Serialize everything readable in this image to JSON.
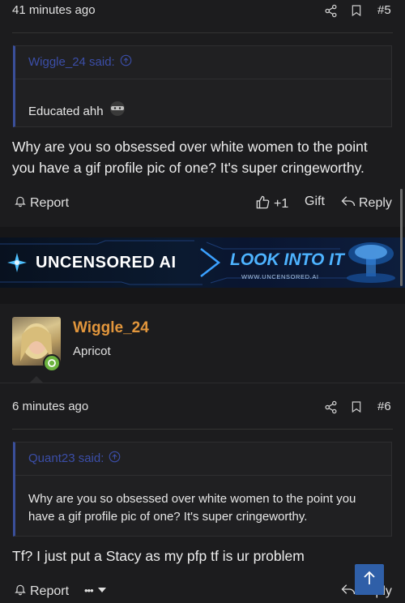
{
  "post5": {
    "time": "41 minutes ago",
    "number": "#5",
    "quote": {
      "author_said": "Wiggle_24 said:",
      "text": "Educated ahh"
    },
    "body": "Why are you so obsessed over white women to the point you have a gif profile pic of one? It's super cringeworthy.",
    "actions": {
      "report": "Report",
      "like_count": "+1",
      "gift": "Gift",
      "reply": "Reply"
    }
  },
  "ad": {
    "brand": "UNCENSORED AI",
    "cta": "LOOK INTO IT",
    "url": "WWW.UNCENSORED.AI"
  },
  "post6": {
    "author": {
      "name": "Wiggle_24",
      "title": "Apricot",
      "online": true
    },
    "time": "6 minutes ago",
    "number": "#6",
    "quote": {
      "author_said": "Quant23 said:",
      "text": "Why are you so obsessed over white women to the point you have a gif profile pic of one? It's super cringeworthy."
    },
    "body": "Tf? I just put a Stacy as my pfp tf is ur problem",
    "actions": {
      "report": "Report",
      "more": "•••",
      "reply": "Reply"
    }
  },
  "colors": {
    "background": "#1c1c1e",
    "username": "#e2963c",
    "quote_border": "#3a4f9a",
    "online": "#6cb33f",
    "scroll_top_button": "#2f5fa8"
  },
  "icons": [
    "share-icon",
    "bookmark-icon",
    "arrow-up-circle-icon",
    "bell-icon",
    "thumbs-up-icon",
    "reply-icon",
    "chevron-down-icon",
    "arrow-up-icon"
  ]
}
